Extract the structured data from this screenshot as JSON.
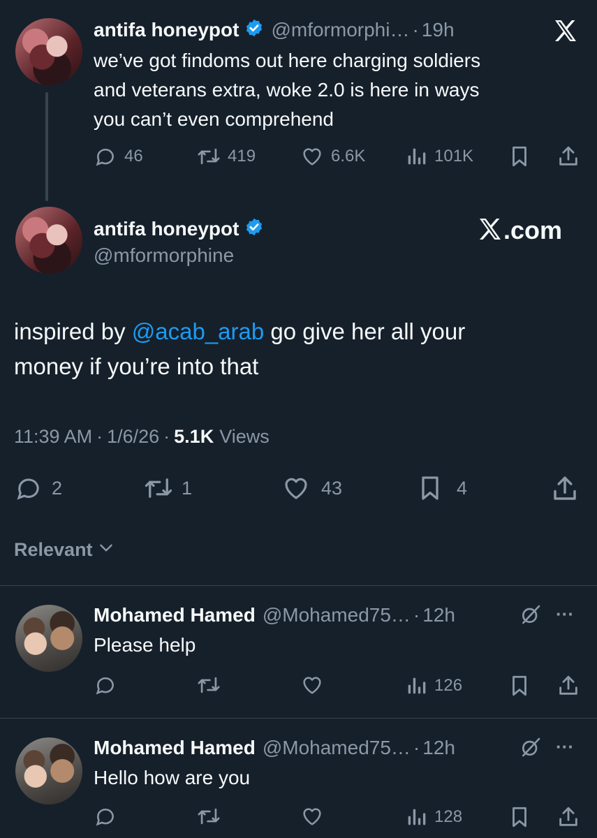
{
  "quoted_tweet": {
    "display_name": "antifa honeypot",
    "handle": "@mformorphi…",
    "separator": "·",
    "time": "19h",
    "text_lines": [
      "we’ve got findoms out here charging soldiers",
      "and veterans extra, woke 2.0 is here in ways",
      "you can’t even comprehend"
    ],
    "replies": "46",
    "reposts": "419",
    "likes": "6.6K",
    "views": "101K"
  },
  "main_tweet": {
    "display_name": "antifa honeypot",
    "handle": "@mformorphine",
    "watermark": "X.com",
    "text_prefix": "inspired by ",
    "mention": "@acab_arab",
    "text_suffix": " go give her all your",
    "text_line2": "money if you’re into that",
    "time": "11:39 AM",
    "date": "1/6/26",
    "sep": "·",
    "views_count": "5.1K",
    "views_label": "Views",
    "replies": "2",
    "reposts": "1",
    "likes": "43",
    "bookmarks": "4"
  },
  "sort": {
    "label": "Relevant"
  },
  "replies": [
    {
      "display_name": "Mohamed Hamed",
      "handle": "@Mohamed75…",
      "separator": "·",
      "time": "12h",
      "more": "···",
      "text": "Please help",
      "views": "126"
    },
    {
      "display_name": "Mohamed Hamed",
      "handle": "@Mohamed75…",
      "separator": "·",
      "time": "12h",
      "more": "···",
      "text": "Hello how are you",
      "views": "128"
    }
  ],
  "colors": {
    "background": "#15202b",
    "text": "#f7f9f9",
    "muted": "#8b98a5",
    "link": "#1d9bf0",
    "verified": "#1d9bf0",
    "divider": "#38444d"
  },
  "icons": [
    "x-logo-icon",
    "verified-badge-icon",
    "reply-icon",
    "repost-icon",
    "like-icon",
    "views-icon",
    "bookmark-icon",
    "share-icon",
    "chevron-down-icon",
    "grok-icon",
    "more-icon"
  ]
}
